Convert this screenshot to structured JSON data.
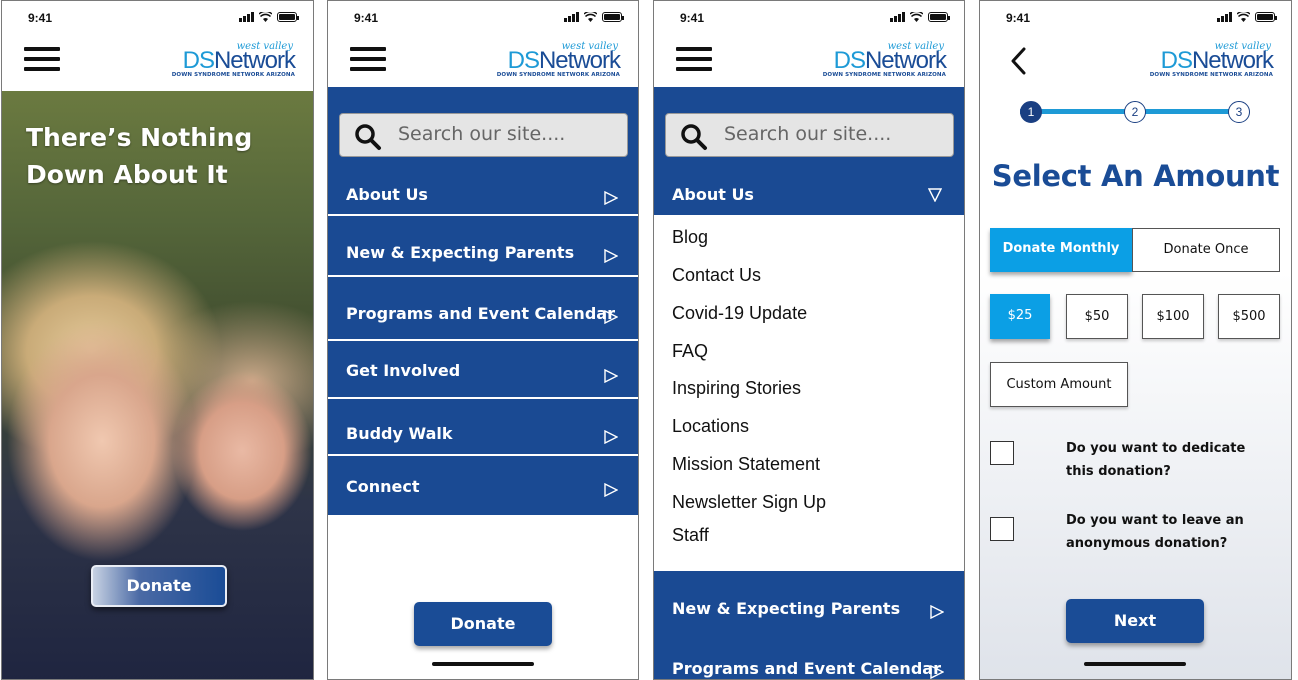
{
  "status_time": "9:41",
  "logo": {
    "script": "west valley",
    "ds": "DS",
    "network": "Network",
    "tagline": "DOWN SYNDROME NETWORK ARIZONA"
  },
  "home": {
    "hero_title": "There’s Nothing Down About It",
    "donate_label": "Donate"
  },
  "search": {
    "placeholder": "Search our site...."
  },
  "menu": {
    "items": [
      "About Us",
      "New & Expecting Parents",
      "Programs and Event Calendar",
      "Get Involved",
      "Buddy Walk",
      "Connect"
    ],
    "donate_label": "Donate"
  },
  "about_submenu": {
    "items": [
      "Blog",
      "Contact Us",
      "Covid-19 Update",
      "FAQ",
      "Inspiring Stories",
      "Locations",
      "Mission Statement",
      "Newsletter Sign Up",
      "Staff"
    ]
  },
  "donation": {
    "steps": [
      "1",
      "2",
      "3"
    ],
    "title": "Select An Amount",
    "frequency": [
      "Donate Monthly",
      "Donate Once"
    ],
    "amounts": [
      "$25",
      "$50",
      "$100",
      "$500"
    ],
    "custom_label": "Custom  Amount",
    "questions": [
      "Do you want to dedicate this donation?",
      "Do you want to leave an anonymous donation?"
    ],
    "next_label": "Next"
  },
  "colors": {
    "navy": "#1a4c96",
    "menu_blue": "#1a4a93",
    "accent_blue": "#0b9fe5"
  }
}
